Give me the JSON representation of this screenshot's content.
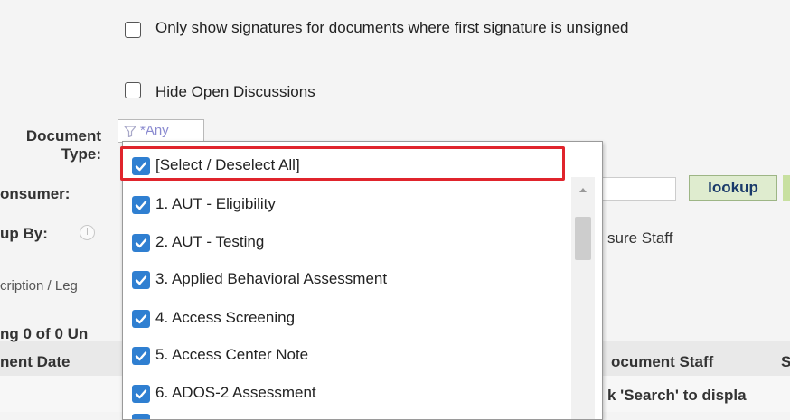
{
  "options": {
    "only_show_unsigned": "Only show signatures for documents where first signature is unsigned",
    "hide_open_discussions": "Hide Open Discussions"
  },
  "labels": {
    "document_type": "Document Type:",
    "consumer": "onsumer:",
    "group_by": "up By:",
    "description": "cription / Leg",
    "showing": "ng 0 of 0 Un",
    "document_date": "nent Date"
  },
  "filter": {
    "value": "*Any"
  },
  "buttons": {
    "lookup": "lookup"
  },
  "right_fragments": {
    "staff_option": "sure Staff",
    "document_staff": "ocument Staff",
    "col_s": "S",
    "search_hint": "k 'Search' to displa"
  },
  "dropdown": {
    "select_all": "[Select / Deselect All]",
    "items": [
      "1. AUT - Eligibility",
      "2. AUT - Testing",
      "3. Applied Behavioral Assessment",
      "4. Access Screening",
      "5. Access Center Note",
      "6. ADOS-2 Assessment"
    ]
  },
  "colors": {
    "checkbox": "#2f7fd1",
    "highlight": "#e0242c",
    "lookup_bg": "#dfeccf"
  }
}
